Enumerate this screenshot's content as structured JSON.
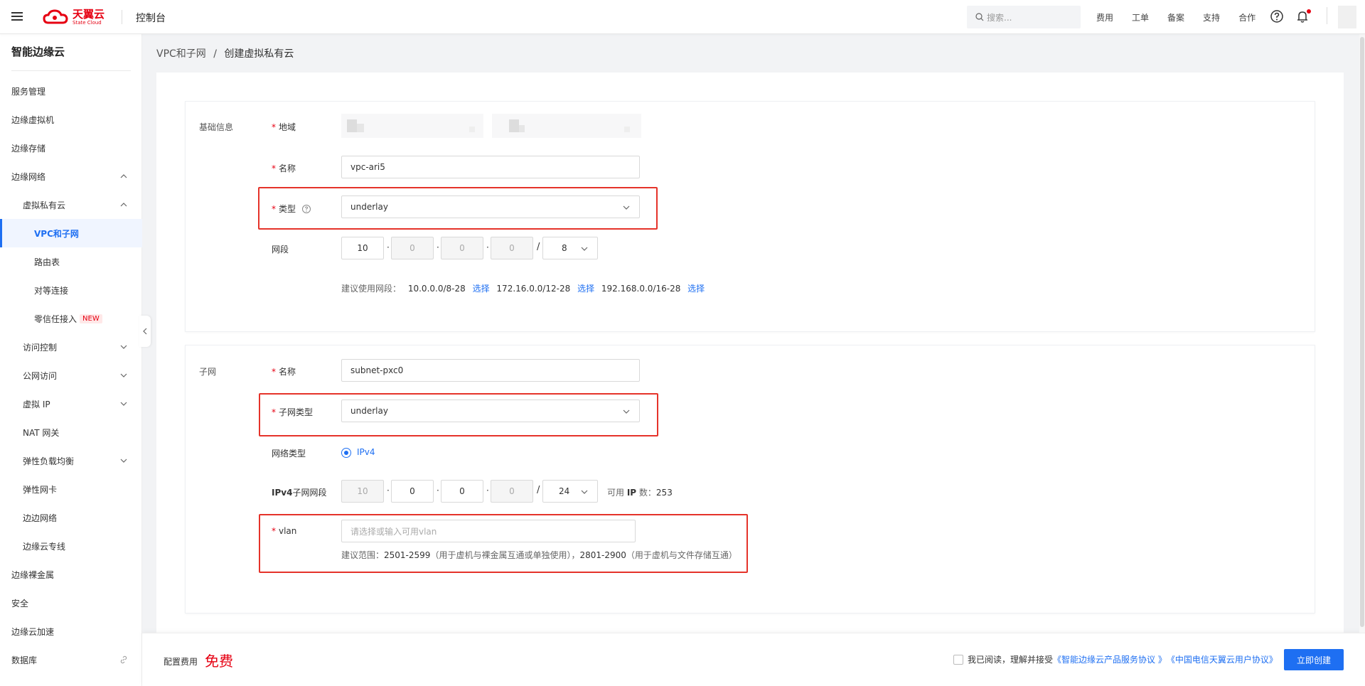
{
  "header": {
    "logo_cn": "天翼云",
    "logo_en": "State Cloud",
    "console": "控制台",
    "search_placeholder": "搜索...",
    "links": [
      "费用",
      "工单",
      "备案",
      "支持",
      "合作"
    ]
  },
  "sidebar": {
    "title": "智能边缘云",
    "items": [
      {
        "label": "服务管理"
      },
      {
        "label": "边缘虚拟机"
      },
      {
        "label": "边缘存储"
      },
      {
        "label": "边缘网络"
      },
      {
        "label": "虚拟私有云"
      },
      {
        "label": "VPC和子网"
      },
      {
        "label": "路由表"
      },
      {
        "label": "对等连接"
      },
      {
        "label": "零信任接入",
        "badge": "NEW"
      },
      {
        "label": "访问控制"
      },
      {
        "label": "公网访问"
      },
      {
        "label": "虚拟 IP"
      },
      {
        "label": "NAT 网关"
      },
      {
        "label": "弹性负载均衡"
      },
      {
        "label": "弹性网卡"
      },
      {
        "label": "边边网络"
      },
      {
        "label": "边缘云专线"
      },
      {
        "label": "边缘裸金属"
      },
      {
        "label": "安全"
      },
      {
        "label": "边缘云加速"
      },
      {
        "label": "数据库"
      }
    ]
  },
  "breadcrumb": {
    "parent": "VPC和子网",
    "sep": "/",
    "current": "创建虚拟私有云"
  },
  "basic": {
    "section": "基础信息",
    "region_label": "地域",
    "name_label": "名称",
    "name_value": "vpc-ari5",
    "type_label": "类型",
    "type_value": "underlay",
    "cidr_label": "网段",
    "cidr": [
      "10",
      "0",
      "0",
      "0"
    ],
    "mask": "8",
    "hint_prefix": "建议使用网段：",
    "suggest": [
      {
        "range": "10.0.0.0/8-28",
        "action": "选择"
      },
      {
        "range": "172.16.0.0/12-28",
        "action": "选择"
      },
      {
        "range": "192.168.0.0/16-28",
        "action": "选择"
      }
    ]
  },
  "subnet": {
    "section": "子网",
    "name_label": "名称",
    "name_value": "subnet-pxc0",
    "type_label": "子网类型",
    "type_value": "underlay",
    "net_type_label": "网络类型",
    "net_type_value": "IPv4",
    "ipv4_label_a": "IPv4",
    "ipv4_label_b": "子网网段",
    "cidr": [
      "10",
      "0",
      "0",
      "0"
    ],
    "mask": "24",
    "avail_a": "可用 ",
    "avail_ip": "IP",
    "avail_b": " 数：",
    "avail_num": "253",
    "vlan_label": "vlan",
    "vlan_placeholder": "请选择或输入可用vlan",
    "vlan_hint_a": "建议范围：",
    "vlan_range1": "2501-2599",
    "vlan_hint_b": "（用于虚机与裸金属互通或单独使用），",
    "vlan_range2": "2801-2900",
    "vlan_hint_c": "（用于虚机与文件存储互通）"
  },
  "footer": {
    "fee_label": "配置费用",
    "fee_value": "免费",
    "agree_text": "我已阅读，理解并接受",
    "agreement1": "《智能边缘云产品服务协议 》",
    "agreement2": "《中国电信天翼云用户协议》",
    "create": "立即创建"
  },
  "colors": {
    "accent": "#1e6ff2",
    "brand": "#e60012",
    "highlight": "#e5332a"
  }
}
